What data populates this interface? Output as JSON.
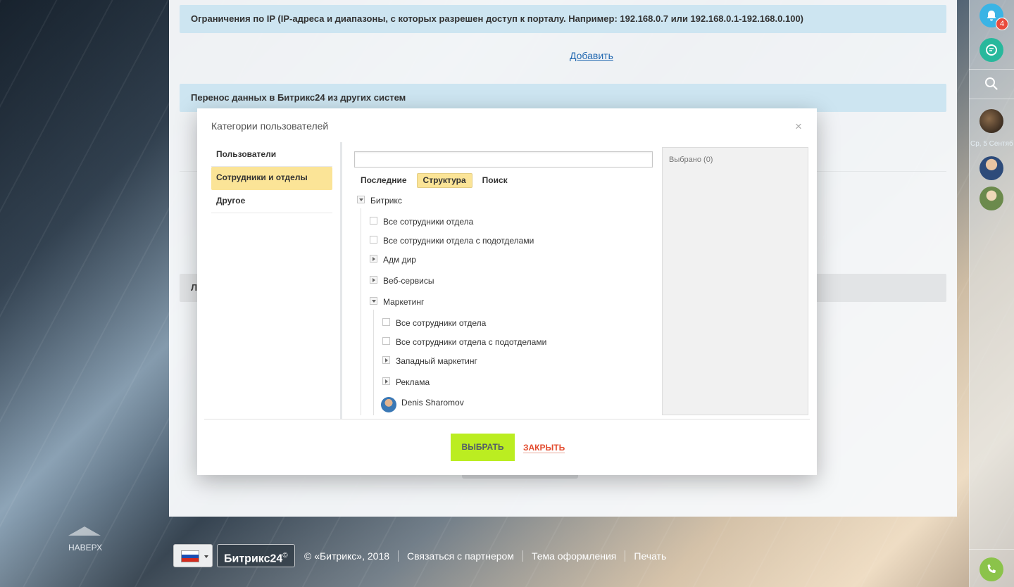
{
  "page": {
    "sections": {
      "ip_header": "Ограничения по IP (IP-адреса и диапазоны, с которых разрешен доступ к порталу. Например: 192.168.0.7 или 192.168.0.1-192.168.0.100)",
      "add_link": "Добавить",
      "migrate_header": "Перенос данных в Битрикс24 из других систем",
      "gray_header_partial": "Л"
    }
  },
  "right_bar": {
    "notifications_count": "4",
    "date_label": "Ср, 5 Сентяб",
    "icons": [
      "bell-icon",
      "chat-icon",
      "search-icon",
      "phone-icon"
    ]
  },
  "footer": {
    "scroll_top": "НАВЕРХ",
    "logo": "Битрикс24",
    "logo_mark": "©",
    "copyright": "© «Битрикс», 2018",
    "links": [
      "Связаться с партнером",
      "Тема оформления",
      "Печать"
    ]
  },
  "modal": {
    "title": "Категории пользователей",
    "close": "×",
    "categories": [
      "Пользователи",
      "Сотрудники и отделы",
      "Другое"
    ],
    "active_category": "Сотрудники и отделы",
    "search_value": "",
    "tabs": [
      "Последние",
      "Структура",
      "Поиск"
    ],
    "active_tab": "Структура",
    "tree": {
      "root": "Битрикс",
      "root_items": [
        "Все сотрудники отдела",
        "Все сотрудники отдела с подотделами"
      ],
      "departments": [
        "Адм дир",
        "Веб-сервисы",
        "Маркетинг"
      ],
      "marketing_items": [
        "Все сотрудники отдела",
        "Все сотрудники отдела с подотделами"
      ],
      "marketing_subdepartments": [
        "Западный маркетинг",
        "Реклама"
      ],
      "employee": "Denis Sharomov"
    },
    "selected_label": "Выбрано (0)",
    "select_button": "ВЫБРАТЬ",
    "close_button": "ЗАКРЫТЬ"
  },
  "colors": {
    "section_header": "#cde5f1",
    "accent_yellow": "#fbe497",
    "select_button": "#bbed21",
    "close_link": "#e34b2e",
    "link": "#2067b0",
    "badge": "#e94b3c"
  }
}
